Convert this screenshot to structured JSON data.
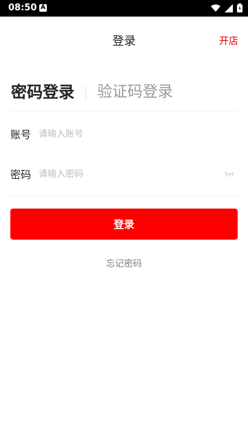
{
  "status_bar": {
    "time": "08:50",
    "a_badge": "A",
    "icons": [
      "wifi-icon",
      "signal-icon",
      "battery-icon"
    ]
  },
  "header": {
    "title": "登录",
    "right_link": "开店"
  },
  "tabs": {
    "active": "密码登录",
    "inactive": "验证码登录"
  },
  "form": {
    "account_label": "账号",
    "account_placeholder": "请输入账号",
    "password_label": "密码",
    "password_placeholder": "请输入密码"
  },
  "actions": {
    "login_label": "登录",
    "forgot_label": "忘记密码"
  },
  "colors": {
    "accent": "#ff0000",
    "link": "#e60000"
  }
}
